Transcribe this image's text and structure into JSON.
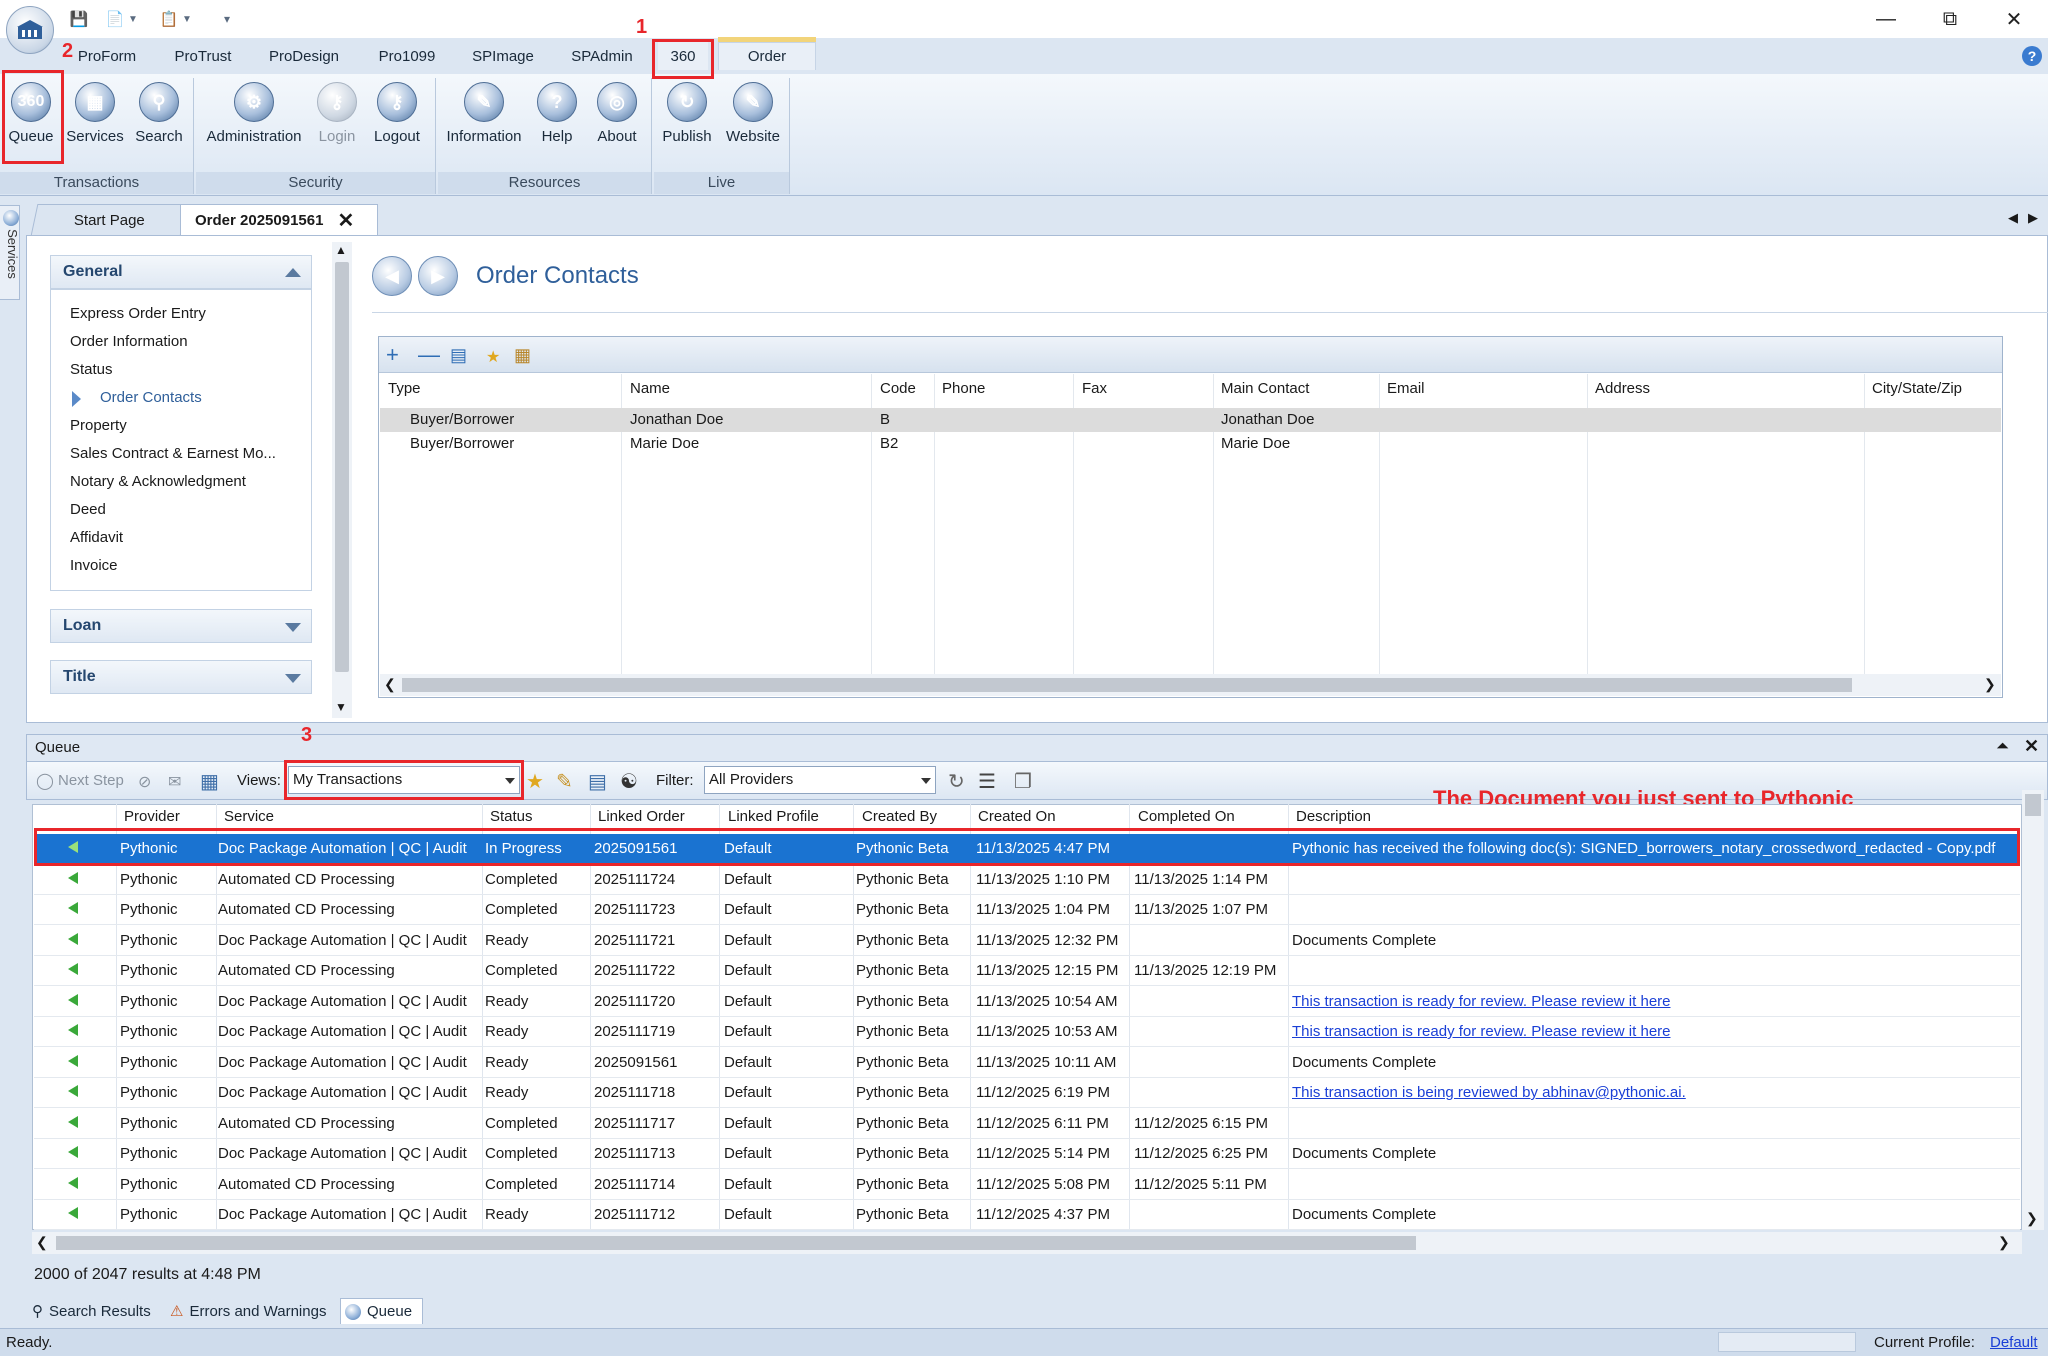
{
  "ribbon": {
    "tabs": [
      "ProForm",
      "ProTrust",
      "ProDesign",
      "Pro1099",
      "SPImage",
      "SPAdmin",
      "360",
      "Order"
    ],
    "groups": [
      {
        "label": "Transactions",
        "buttons": [
          "Queue",
          "Services",
          "Search"
        ]
      },
      {
        "label": "Security",
        "buttons": [
          "Administration",
          "Login",
          "Logout"
        ]
      },
      {
        "label": "Resources",
        "buttons": [
          "Information",
          "Help",
          "About"
        ]
      },
      {
        "label": "Live",
        "buttons": [
          "Publish",
          "Website"
        ]
      }
    ],
    "queue_icon_text": "360"
  },
  "annotations": {
    "num1": "1",
    "num2": "2",
    "num3": "3",
    "note": "The Document you just sent to Pythonic"
  },
  "side": {
    "services": "Services"
  },
  "doc_tabs": {
    "start": "Start Page",
    "order": "Order 2025091561"
  },
  "nav": {
    "general": "General",
    "items": [
      "Express Order Entry",
      "Order Information",
      "Status",
      "Order Contacts",
      "Property",
      "Sales Contract & Earnest Mo...",
      "Notary & Acknowledgment",
      "Deed",
      "Affidavit",
      "Invoice"
    ],
    "loan": "Loan",
    "title": "Title"
  },
  "contacts": {
    "title": "Order Contacts",
    "columns": [
      "Type",
      "Name",
      "Code",
      "Phone",
      "Fax",
      "Main Contact",
      "Email",
      "Address",
      "City/State/Zip"
    ],
    "rows": [
      [
        "Buyer/Borrower",
        "Jonathan Doe",
        "B",
        "",
        "",
        "Jonathan Doe",
        "",
        "",
        ""
      ],
      [
        "Buyer/Borrower",
        "Marie Doe",
        "B2",
        "",
        "",
        "Marie Doe",
        "",
        "",
        ""
      ]
    ]
  },
  "queue": {
    "title": "Queue",
    "toolbar": {
      "next_step": "Next Step",
      "views_label": "Views:",
      "views_value": "My Transactions",
      "filter_label": "Filter:",
      "filter_value": "All Providers"
    },
    "columns": [
      "Provider",
      "Service",
      "Status",
      "Linked Order",
      "Linked Profile",
      "Created By",
      "Created On",
      "Completed On",
      "Description"
    ],
    "rows": [
      [
        "Pythonic",
        "Doc Package Automation | QC | Audit",
        "In Progress",
        "2025091561",
        "Default",
        "Pythonic Beta",
        "11/13/2025 4:47 PM",
        "",
        "Pythonic has received the following doc(s): SIGNED_borrowers_notary_crossedword_redacted - Copy.pdf"
      ],
      [
        "Pythonic",
        "Automated CD Processing",
        "Completed",
        "2025111724",
        "Default",
        "Pythonic Beta",
        "11/13/2025 1:10 PM",
        "11/13/2025 1:14 PM",
        ""
      ],
      [
        "Pythonic",
        "Automated CD Processing",
        "Completed",
        "2025111723",
        "Default",
        "Pythonic Beta",
        "11/13/2025 1:04 PM",
        "11/13/2025 1:07 PM",
        ""
      ],
      [
        "Pythonic",
        "Doc Package Automation | QC | Audit",
        "Ready",
        "2025111721",
        "Default",
        "Pythonic Beta",
        "11/13/2025 12:32 PM",
        "",
        "Documents Complete"
      ],
      [
        "Pythonic",
        "Automated CD Processing",
        "Completed",
        "2025111722",
        "Default",
        "Pythonic Beta",
        "11/13/2025 12:15 PM",
        "11/13/2025 12:19 PM",
        ""
      ],
      [
        "Pythonic",
        "Doc Package Automation | QC | Audit",
        "Ready",
        "2025111720",
        "Default",
        "Pythonic Beta",
        "11/13/2025 10:54 AM",
        "",
        "This transaction is ready for review. Please review it here "
      ],
      [
        "Pythonic",
        "Doc Package Automation | QC | Audit",
        "Ready",
        "2025111719",
        "Default",
        "Pythonic Beta",
        "11/13/2025 10:53 AM",
        "",
        "This transaction is ready for review. Please review it here "
      ],
      [
        "Pythonic",
        "Doc Package Automation | QC | Audit",
        "Ready",
        "2025091561",
        "Default",
        "Pythonic Beta",
        "11/13/2025 10:11 AM",
        "",
        "Documents Complete"
      ],
      [
        "Pythonic",
        "Doc Package Automation | QC | Audit",
        "Ready",
        "2025111718",
        "Default",
        "Pythonic Beta",
        "11/12/2025 6:19 PM",
        "",
        "This transaction is being reviewed by abhinav@pythonic.ai. "
      ],
      [
        "Pythonic",
        "Automated CD Processing",
        "Completed",
        "2025111717",
        "Default",
        "Pythonic Beta",
        "11/12/2025 6:11 PM",
        "11/12/2025 6:15 PM",
        ""
      ],
      [
        "Pythonic",
        "Doc Package Automation | QC | Audit",
        "Completed",
        "2025111713",
        "Default",
        "Pythonic Beta",
        "11/12/2025 5:14 PM",
        "11/12/2025 6:25 PM",
        "Documents Complete"
      ],
      [
        "Pythonic",
        "Automated CD Processing",
        "Completed",
        "2025111714",
        "Default",
        "Pythonic Beta",
        "11/12/2025 5:08 PM",
        "11/12/2025 5:11 PM",
        ""
      ],
      [
        "Pythonic",
        "Doc Package Automation | QC | Audit",
        "Ready",
        "2025111712",
        "Default",
        "Pythonic Beta",
        "11/12/2025 4:37 PM",
        "",
        "Documents Complete"
      ]
    ],
    "link_rows": [
      5,
      6,
      8
    ],
    "results": "2000 of 2047 results at 4:48 PM"
  },
  "bottom_tabs": [
    "Search Results",
    "Errors and Warnings",
    "Queue"
  ],
  "status": {
    "text": "Ready.",
    "profile_label": "Current Profile:",
    "profile_value": "Default"
  },
  "colors": {
    "accent_red": "#e8262b",
    "selection_blue": "#1a73d1",
    "link_blue": "#1a3fd6"
  }
}
